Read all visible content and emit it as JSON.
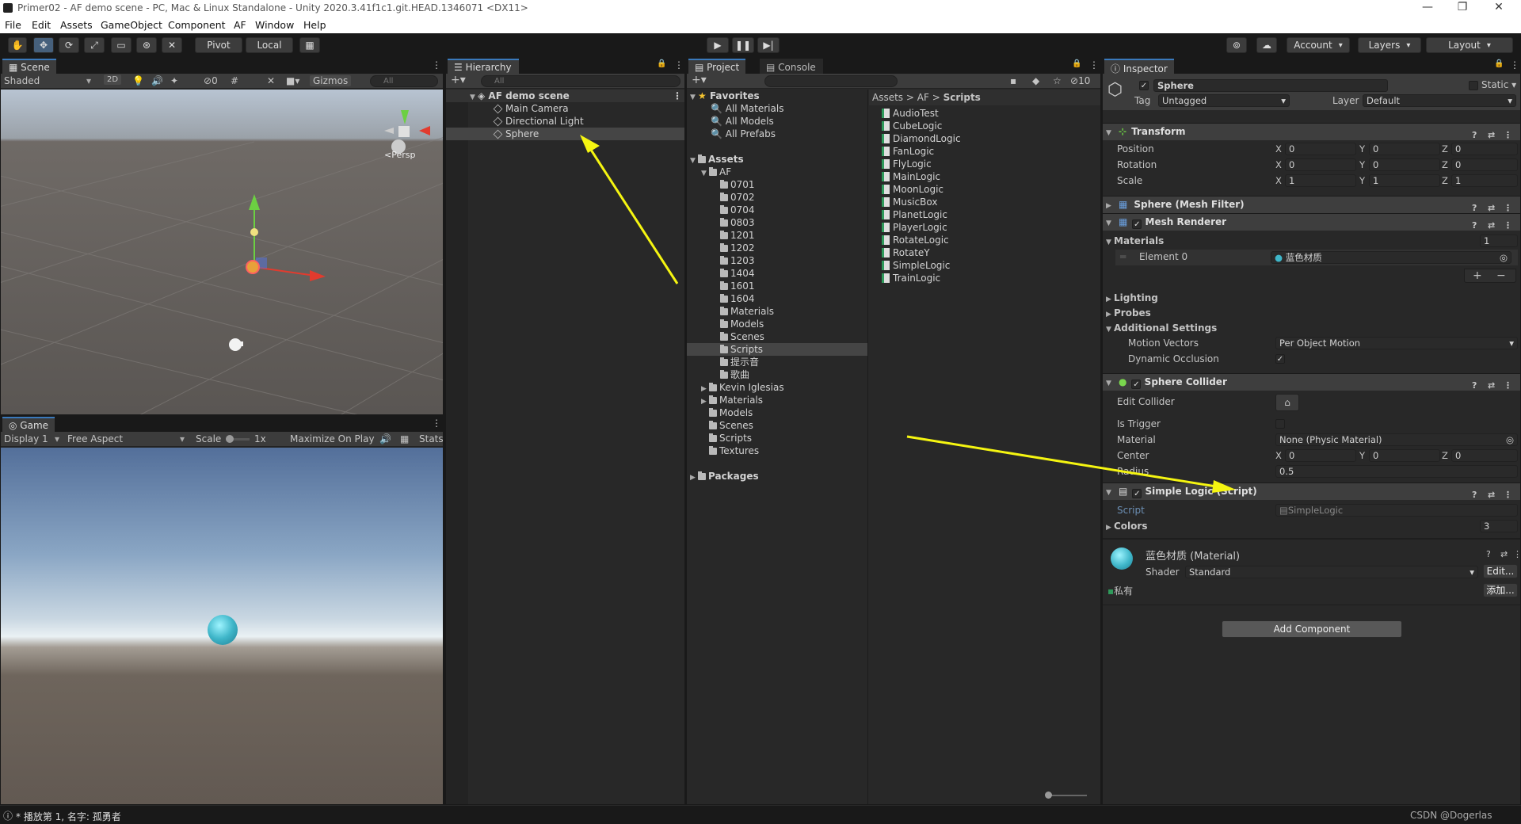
{
  "titlebar": {
    "title": "Primer02 - AF demo scene - PC, Mac & Linux Standalone - Unity 2020.3.41f1c1.git.HEAD.1346071 <DX11>",
    "minimize": "—",
    "maximize": "❐",
    "close": "✕"
  },
  "menu": [
    "File",
    "Edit",
    "Assets",
    "GameObject",
    "Component",
    "AF",
    "Window",
    "Help"
  ],
  "toolbar": {
    "pivot": "Pivot",
    "local": "Local",
    "account": "Account",
    "layers": "Layers",
    "layout": "Layout"
  },
  "scene": {
    "tab": "Scene",
    "shading": "Shaded",
    "mode2d": "2D",
    "hidden_count": "0",
    "gizmos": "Gizmos",
    "search_placeholder": "All",
    "persp": "<Persp"
  },
  "game": {
    "tab": "Game",
    "display": "Display 1",
    "aspect": "Free Aspect",
    "scale_label": "Scale",
    "scale_value": "1x",
    "maximize": "Maximize On Play",
    "stats": "Stats"
  },
  "hierarchy": {
    "tab": "Hierarchy",
    "search_placeholder": "All",
    "scene_name": "AF demo scene",
    "items": [
      "Main Camera",
      "Directional Light",
      "Sphere"
    ],
    "selected": "Sphere"
  },
  "project": {
    "tab": "Project",
    "console_tab": "Console",
    "hidden_count": "10",
    "favorites_label": "Favorites",
    "favorites": [
      "All Materials",
      "All Models",
      "All Prefabs"
    ],
    "assets_label": "Assets",
    "af_label": "AF",
    "af_children": [
      "0701",
      "0702",
      "0704",
      "0803",
      "1201",
      "1202",
      "1203",
      "1404",
      "1601",
      "1604",
      "Materials",
      "Models",
      "Scenes",
      "Scripts",
      "提示音",
      "歌曲"
    ],
    "assets_children": [
      "Kevin Iglesias",
      "Materials",
      "Models",
      "Scenes",
      "Scripts",
      "Textures"
    ],
    "packages_label": "Packages",
    "breadcrumb": [
      "Assets",
      "AF",
      "Scripts"
    ],
    "files": [
      "AudioTest",
      "CubeLogic",
      "DiamondLogic",
      "FanLogic",
      "FlyLogic",
      "MainLogic",
      "MoonLogic",
      "MusicBox",
      "PlanetLogic",
      "PlayerLogic",
      "RotateLogic",
      "RotateY",
      "SimpleLogic",
      "TrainLogic"
    ]
  },
  "inspector": {
    "tab": "Inspector",
    "object_name": "Sphere",
    "static_label": "Static",
    "tag_label": "Tag",
    "tag_value": "Untagged",
    "layer_label": "Layer",
    "layer_value": "Default",
    "transform": {
      "title": "Transform",
      "rows": [
        {
          "label": "Position",
          "x": "0",
          "y": "0",
          "z": "0"
        },
        {
          "label": "Rotation",
          "x": "0",
          "y": "0",
          "z": "0"
        },
        {
          "label": "Scale",
          "x": "1",
          "y": "1",
          "z": "1"
        }
      ]
    },
    "mesh_filter": "Sphere (Mesh Filter)",
    "mesh_renderer": {
      "title": "Mesh Renderer",
      "materials_label": "Materials",
      "materials_count": "1",
      "element_label": "Element 0",
      "element_value": "蓝色材质",
      "lighting": "Lighting",
      "probes": "Probes",
      "additional": "Additional Settings",
      "motion_label": "Motion Vectors",
      "motion_value": "Per Object Motion",
      "occlusion_label": "Dynamic Occlusion"
    },
    "collider": {
      "title": "Sphere Collider",
      "edit_label": "Edit Collider",
      "trigger_label": "Is Trigger",
      "material_label": "Material",
      "material_value": "None (Physic Material)",
      "center_label": "Center",
      "cx": "0",
      "cy": "0",
      "cz": "0",
      "radius_label": "Radius",
      "radius_value": "0.5"
    },
    "script": {
      "title": "Simple Logic (Script)",
      "script_label": "Script",
      "script_value": "SimpleLogic",
      "colors_label": "Colors",
      "colors_value": "3"
    },
    "material": {
      "name": "蓝色材质 (Material)",
      "shader_label": "Shader",
      "shader_value": "Standard",
      "edit": "Edit...",
      "private_label": "私有",
      "add": "添加..."
    },
    "add_component": "Add Component"
  },
  "status": {
    "message": "* 播放第 1, 名字: 孤勇者",
    "watermark": "CSDN @Dogerlas"
  },
  "colors": {
    "accent": "#3a79bb",
    "annotation_arrow": "#f5f511",
    "sphere": "#3fb6c9"
  }
}
